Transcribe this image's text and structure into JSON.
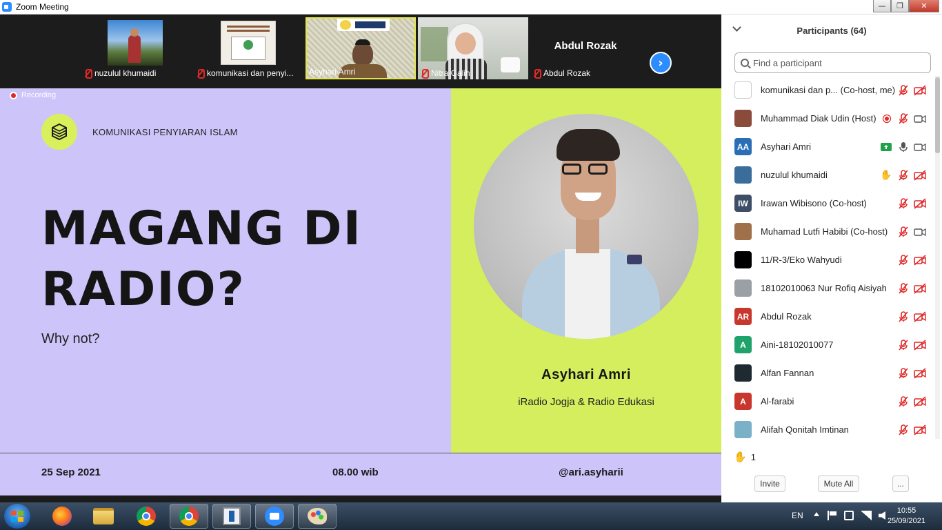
{
  "window": {
    "title": "Zoom Meeting"
  },
  "strip": {
    "tiles": [
      {
        "name": "nuzulul khumaidi"
      },
      {
        "name": "komunikasi dan penyi..."
      },
      {
        "name": "Asyhari Amri"
      },
      {
        "name": "Nitra Galih"
      },
      {
        "name": "Abdul Rozak",
        "big_label": "Abdul Rozak"
      }
    ]
  },
  "slide": {
    "recording": "Recording",
    "org": "KOMUNIKASI PENYIARAN ISLAM",
    "headline_1": "MAGANG DI",
    "headline_2": "RADIO?",
    "subline": "Why not?",
    "speaker": "Asyhari Amri",
    "speaker_role": "iRadio Jogja & Radio Edukasi",
    "date": "25 Sep 2021",
    "time": "08.00 wib",
    "handle": "@ari.asyharii"
  },
  "panel": {
    "title": "Participants (64)",
    "search_placeholder": "Find a participant",
    "participants": [
      {
        "name": "komunikasi dan p... (Co-host, me)",
        "avatar": "",
        "avatar_color": "#ffffff"
      },
      {
        "name": "Muhammad Diak Udin (Host)",
        "avatar": "",
        "avatar_color": "#8a4b3a"
      },
      {
        "name": "Asyhari Amri",
        "avatar": "AA",
        "avatar_color": "#2a6fb5"
      },
      {
        "name": "nuzulul khumaidi",
        "avatar": "",
        "avatar_color": "#3a6d9a"
      },
      {
        "name": "Irawan Wibisono (Co-host)",
        "avatar": "IW",
        "avatar_color": "#3d4f66"
      },
      {
        "name": "Muhamad Lutfi Habibi (Co-host)",
        "avatar": "",
        "avatar_color": "#a0704a"
      },
      {
        "name": "11/R-3/Eko Wahyudi",
        "avatar": "",
        "avatar_color": "#000000"
      },
      {
        "name": "18102010063 Nur Rofiq Aisiyah",
        "avatar": "",
        "avatar_color": "#9aa0a6"
      },
      {
        "name": "Abdul Rozak",
        "avatar": "AR",
        "avatar_color": "#c8372d"
      },
      {
        "name": "Aini-18102010077",
        "avatar": "A",
        "avatar_color": "#1fa36b"
      },
      {
        "name": "Alfan Fannan",
        "avatar": "",
        "avatar_color": "#1f2a30"
      },
      {
        "name": "Al-farabi",
        "avatar": "A",
        "avatar_color": "#c8372d"
      },
      {
        "name": "Alifah Qonitah Imtinan",
        "avatar": "",
        "avatar_color": "#7ab0c8"
      }
    ],
    "raised_hands": "1",
    "invite": "Invite",
    "mute_all": "Mute All",
    "more": "..."
  },
  "taskbar": {
    "language": "EN",
    "time": "10:55",
    "date": "25/09/2021"
  },
  "colors": {
    "slide_bg": "#cdc4fa",
    "accent_lime": "#d4ee5e",
    "zoom_blue": "#2d8cff",
    "muted_red": "#e02828"
  }
}
